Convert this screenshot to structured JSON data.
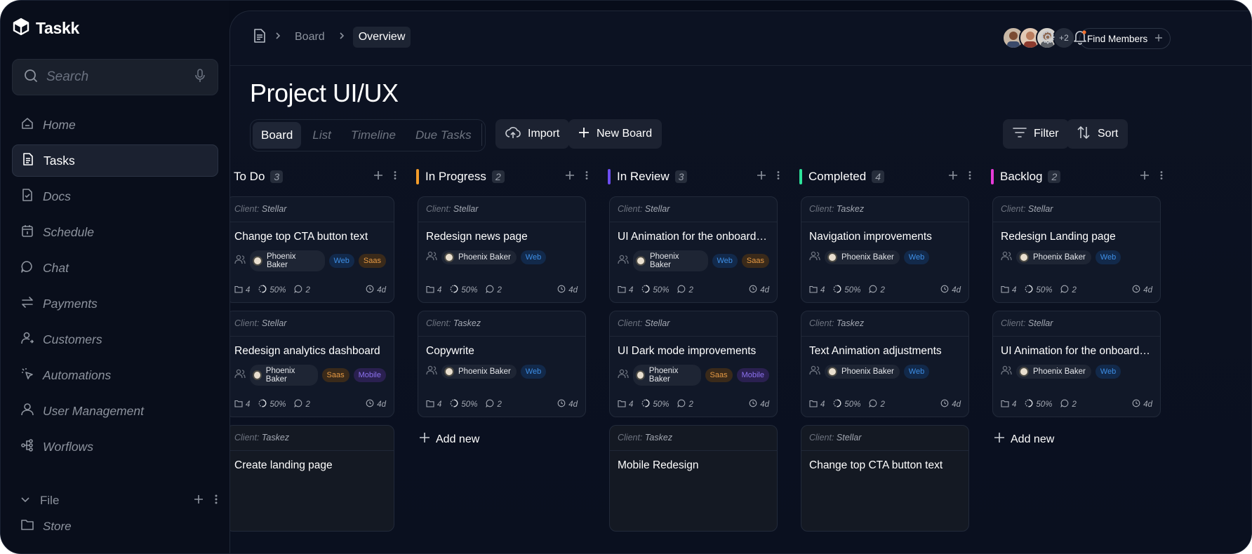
{
  "app": {
    "name": "Taskk"
  },
  "search": {
    "placeholder": "Search"
  },
  "sidebar": {
    "items": [
      {
        "label": "Home",
        "icon": "home-icon",
        "active": false
      },
      {
        "label": "Tasks",
        "icon": "tasks-icon",
        "active": true
      },
      {
        "label": "Docs",
        "icon": "docs-icon",
        "active": false
      },
      {
        "label": "Schedule",
        "icon": "calendar-icon",
        "active": false
      },
      {
        "label": "Chat",
        "icon": "chat-icon",
        "active": false
      },
      {
        "label": "Payments",
        "icon": "transfer-icon",
        "active": false
      },
      {
        "label": "Customers",
        "icon": "customers-icon",
        "active": false
      },
      {
        "label": "Automations",
        "icon": "automation-icon",
        "active": false
      },
      {
        "label": "User Management",
        "icon": "user-icon",
        "active": false
      },
      {
        "label": "Worflows",
        "icon": "workflow-icon",
        "active": false
      }
    ],
    "file_section": {
      "label": "File"
    },
    "store": {
      "label": "Store"
    }
  },
  "breadcrumb": {
    "items": [
      "Board",
      "Overview"
    ]
  },
  "header": {
    "members_more": "+2",
    "find_members": "Find Members"
  },
  "page": {
    "title": "Project UI/UX"
  },
  "views": {
    "tabs": [
      "Board",
      "List",
      "Timeline",
      "Due Tasks"
    ],
    "active": "Board"
  },
  "toolbar": {
    "import": "Import",
    "new_board": "New Board",
    "filter": "Filter",
    "sort": "Sort"
  },
  "columns": [
    {
      "title": "To Do",
      "count": "3",
      "color": "#2f8ff0",
      "cards": [
        {
          "client_label": "Client:",
          "client": "Stellar",
          "title": "Change top CTA button text",
          "assignee": "Phoenix Baker",
          "tags": [
            "Web",
            "Saas"
          ],
          "files": "4",
          "progress": "50%",
          "comments": "2",
          "time": "4d"
        },
        {
          "client_label": "Client:",
          "client": "Stellar",
          "title": "Redesign analytics dashboard",
          "assignee": "Phoenix Baker",
          "tags": [
            "Saas",
            "Mobile"
          ],
          "files": "4",
          "progress": "50%",
          "comments": "2",
          "time": "4d"
        },
        {
          "client_label": "Client:",
          "client": "Taskez",
          "title": "Create landing page",
          "dim": true
        }
      ]
    },
    {
      "title": "In Progress",
      "count": "2",
      "color": "#f39c2a",
      "cards": [
        {
          "client_label": "Client:",
          "client": "Stellar",
          "title": "Redesign news page",
          "assignee": "Phoenix Baker",
          "tags": [
            "Web"
          ],
          "files": "4",
          "progress": "50%",
          "comments": "2",
          "time": "4d"
        },
        {
          "client_label": "Client:",
          "client": "Taskez",
          "title": "Copywrite",
          "assignee": "Phoenix Baker",
          "tags": [
            "Web"
          ],
          "files": "4",
          "progress": "50%",
          "comments": "2",
          "time": "4d"
        }
      ],
      "add_new": "Add new"
    },
    {
      "title": "In Review",
      "count": "3",
      "color": "#6c4df0",
      "cards": [
        {
          "client_label": "Client:",
          "client": "Stellar",
          "title": "UI Animation for the onboarding flow",
          "assignee": "Phoenix Baker",
          "tags": [
            "Web",
            "Saas"
          ],
          "files": "4",
          "progress": "50%",
          "comments": "2",
          "time": "4d"
        },
        {
          "client_label": "Client:",
          "client": "Stellar",
          "title": "UI Dark mode improvements",
          "assignee": "Phoenix Baker",
          "tags": [
            "Saas",
            "Mobile"
          ],
          "files": "4",
          "progress": "50%",
          "comments": "2",
          "time": "4d"
        },
        {
          "client_label": "Client:",
          "client": "Taskez",
          "title": "Mobile Redesign",
          "dim": true
        }
      ]
    },
    {
      "title": "Completed",
      "count": "4",
      "color": "#2de39a",
      "cards": [
        {
          "client_label": "Client:",
          "client": "Taskez",
          "title": "Navigation improvements",
          "assignee": "Phoenix Baker",
          "tags": [
            "Web"
          ],
          "files": "4",
          "progress": "50%",
          "comments": "2",
          "time": "4d"
        },
        {
          "client_label": "Client:",
          "client": "Taskez",
          "title": "Text Animation adjustments",
          "assignee": "Phoenix Baker",
          "tags": [
            "Web"
          ],
          "files": "4",
          "progress": "50%",
          "comments": "2",
          "time": "4d"
        },
        {
          "client_label": "Client:",
          "client": "Stellar",
          "title": "Change top CTA button text",
          "dim": true
        }
      ]
    },
    {
      "title": "Backlog",
      "count": "2",
      "color": "#e63bd8",
      "cards": [
        {
          "client_label": "Client:",
          "client": "Stellar",
          "title": "Redesign Landing page",
          "assignee": "Phoenix Baker",
          "tags": [
            "Web"
          ],
          "files": "4",
          "progress": "50%",
          "comments": "2",
          "time": "4d"
        },
        {
          "client_label": "Client:",
          "client": "Stellar",
          "title": "UI Animation for the onboarding",
          "assignee": "Phoenix Baker",
          "tags": [
            "Web"
          ],
          "files": "4",
          "progress": "50%",
          "comments": "2",
          "time": "4d"
        }
      ],
      "add_new": "Add new"
    }
  ]
}
